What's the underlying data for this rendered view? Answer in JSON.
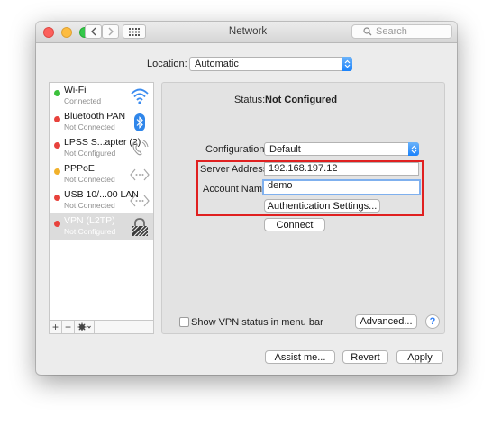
{
  "window": {
    "title": "Network"
  },
  "search": {
    "placeholder": "Search"
  },
  "location": {
    "label": "Location:",
    "value": "Automatic"
  },
  "services": [
    {
      "name": "Wi-Fi",
      "status": "Connected",
      "dot": "#3cc13c",
      "icon": "wifi-icon"
    },
    {
      "name": "Bluetooth PAN",
      "status": "Not Connected",
      "dot": "#e8423c",
      "icon": "bluetooth-icon"
    },
    {
      "name": "LPSS S...apter (2)",
      "status": "Not Configured",
      "dot": "#e8423c",
      "icon": "phone-icon"
    },
    {
      "name": "PPPoE",
      "status": "Not Connected",
      "dot": "#f1b12b",
      "icon": "ethernet-icon"
    },
    {
      "name": "USB 10/...00 LAN",
      "status": "Not Connected",
      "dot": "#e8423c",
      "icon": "ethernet-icon"
    },
    {
      "name": "VPN (L2TP)",
      "status": "Not Configured",
      "dot": "#e8423c",
      "icon": "vpn-lock-icon",
      "selected": true
    }
  ],
  "sidebar_footer": {
    "add": "+",
    "remove": "−"
  },
  "detail": {
    "status_label": "Status:",
    "status_value": "Not Configured",
    "configuration_label": "Configuration:",
    "configuration_value": "Default",
    "server_label": "Server Address:",
    "server_value": "192.168.197.12",
    "account_label": "Account Name:",
    "account_value": "demo",
    "auth_button": "Authentication Settings...",
    "connect_button": "Connect",
    "show_vpn_label": "Show VPN status in menu bar",
    "advanced_button": "Advanced...",
    "help": "?"
  },
  "footer": {
    "assist": "Assist me...",
    "revert": "Revert",
    "apply": "Apply"
  }
}
